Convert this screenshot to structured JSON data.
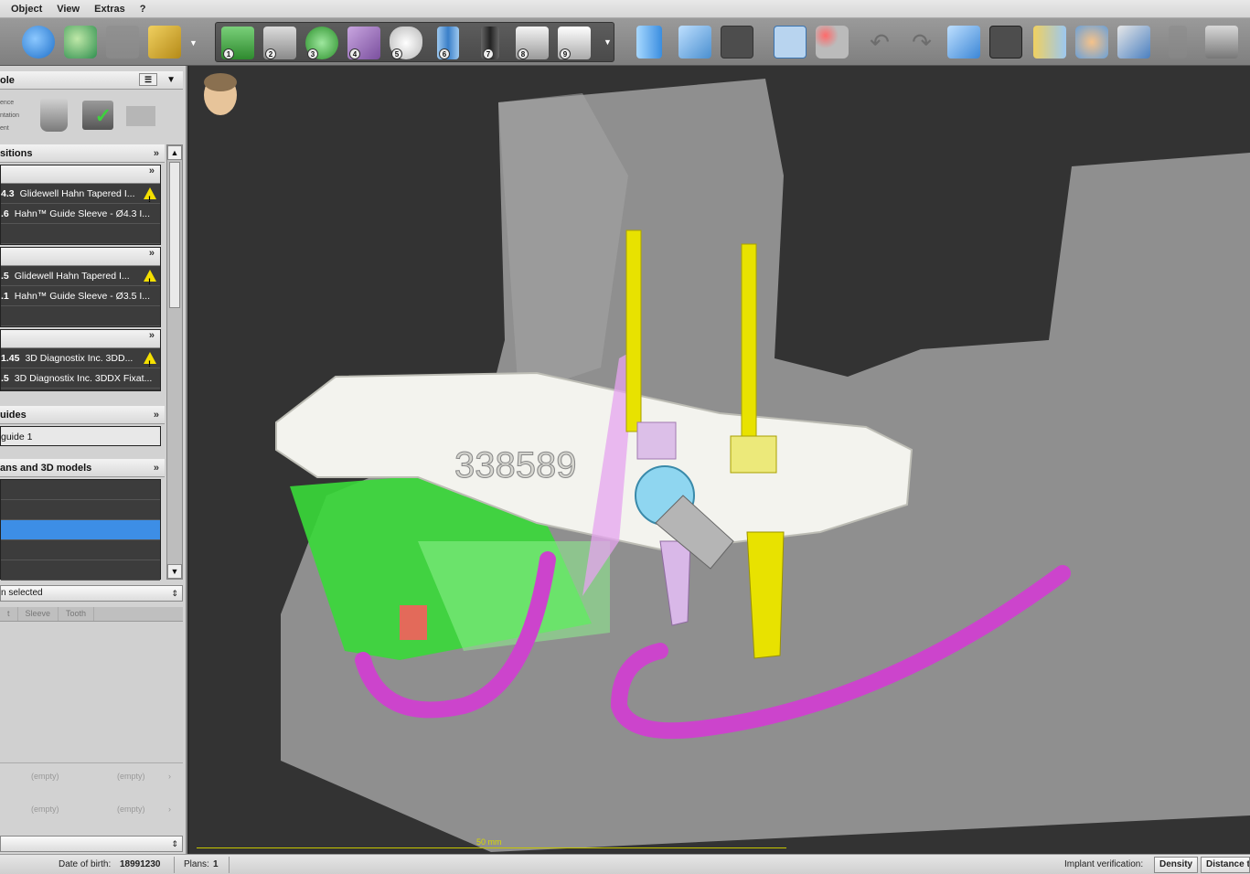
{
  "menu": {
    "object": "Object",
    "view": "View",
    "extras": "Extras",
    "help": "?"
  },
  "toolbar": {
    "steps": [
      "1",
      "2",
      "3",
      "4",
      "5",
      "6",
      "7",
      "8",
      "9"
    ]
  },
  "left_panel": {
    "top_header": "ole",
    "side_labels": [
      "ence",
      "ntation",
      "ent"
    ],
    "positions": {
      "header": "sitions",
      "group1": [
        {
          "pre": "4.3",
          "label": "Glidewell Hahn Tapered I...",
          "warn": true
        },
        {
          "pre": ".6",
          "label": "Hahn™ Guide Sleeve - Ø4.3 I...",
          "warn": false
        }
      ],
      "group2": [
        {
          "pre": ".5",
          "label": "Glidewell Hahn Tapered I...",
          "warn": true
        },
        {
          "pre": ".1",
          "label": "Hahn™ Guide Sleeve - Ø3.5 I...",
          "warn": false
        }
      ],
      "group3": [
        {
          "pre": "1.45",
          "label": "3D Diagnostix Inc. 3DD...",
          "warn": true
        },
        {
          "pre": ".5",
          "label": "3D Diagnostix Inc. 3DDX Fixat...",
          "warn": false
        }
      ]
    },
    "guides": {
      "header": "uides",
      "item": "guide 1"
    },
    "scans": {
      "header": "ans and 3D models"
    },
    "selection": {
      "label": "n selected"
    },
    "tabs": [
      "t",
      "Sleeve",
      "Tooth"
    ],
    "empty_label": "(empty)"
  },
  "viewport": {
    "guide_number": "338589",
    "scale_label": "50 mm"
  },
  "statusbar": {
    "dob_label": "Date of birth:",
    "dob_value": "18991230",
    "plans_label": "Plans:",
    "plans_value": "1",
    "verification_label": "Implant verification:",
    "density_btn": "Density",
    "distance_btn": "Distance t"
  },
  "colors": {
    "implant_yellow": "#e8e200",
    "implant_lilac": "#d9b8e8",
    "nerve_magenta": "#cc44cc",
    "teeth_green": "#39d939",
    "bone_gray": "#8a8a8a",
    "selection_blue": "#3d8ee6"
  }
}
